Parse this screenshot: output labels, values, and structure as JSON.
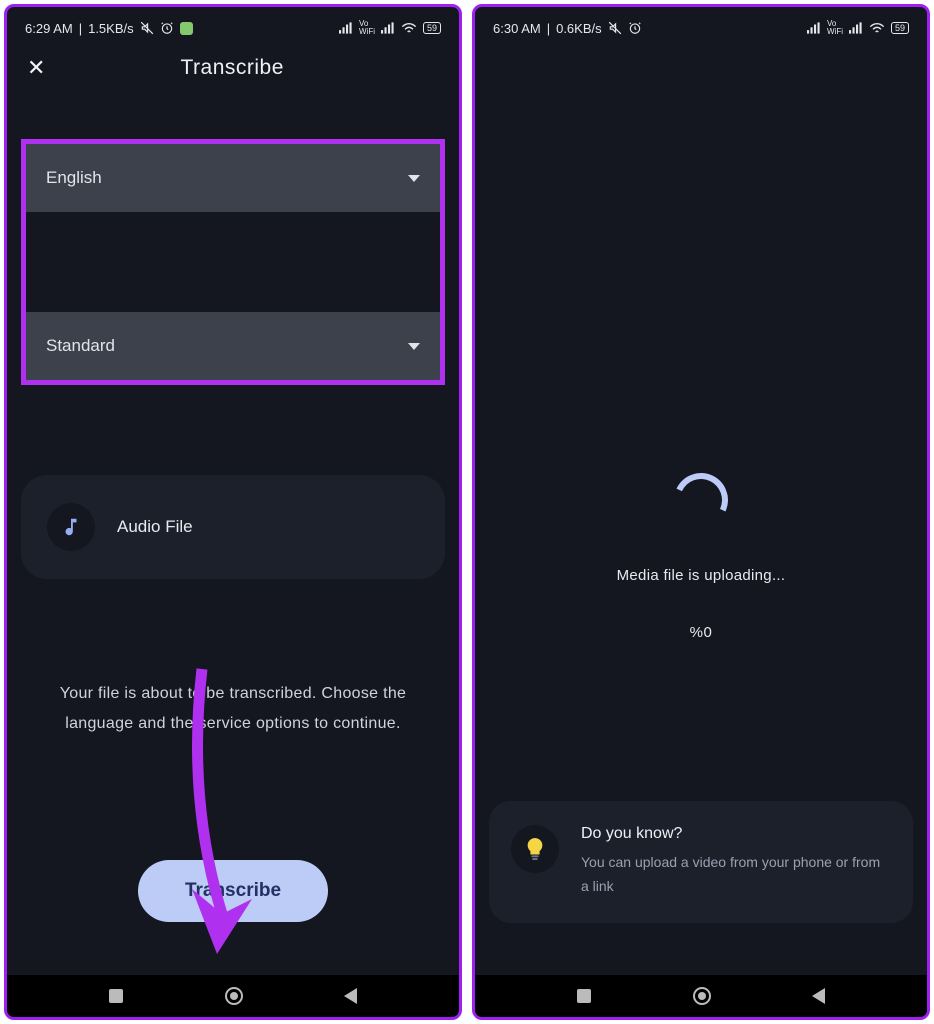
{
  "left": {
    "status": {
      "time": "6:29 AM",
      "net": "1.5KB/s"
    },
    "title": "Transcribe",
    "dropdowns": {
      "language": "English",
      "service": "Standard"
    },
    "file": {
      "label": "Audio File"
    },
    "help": "Your file is about to be transcribed. Choose the language and the service options to continue.",
    "cta": "Transcribe"
  },
  "right": {
    "status": {
      "time": "6:30 AM",
      "net": "0.6KB/s"
    },
    "uploading": {
      "message": "Media file is uploading...",
      "percent": "%0"
    },
    "tip": {
      "title": "Do you know?",
      "body": "You can upload a video from your phone or from a link"
    }
  },
  "battery": "59"
}
